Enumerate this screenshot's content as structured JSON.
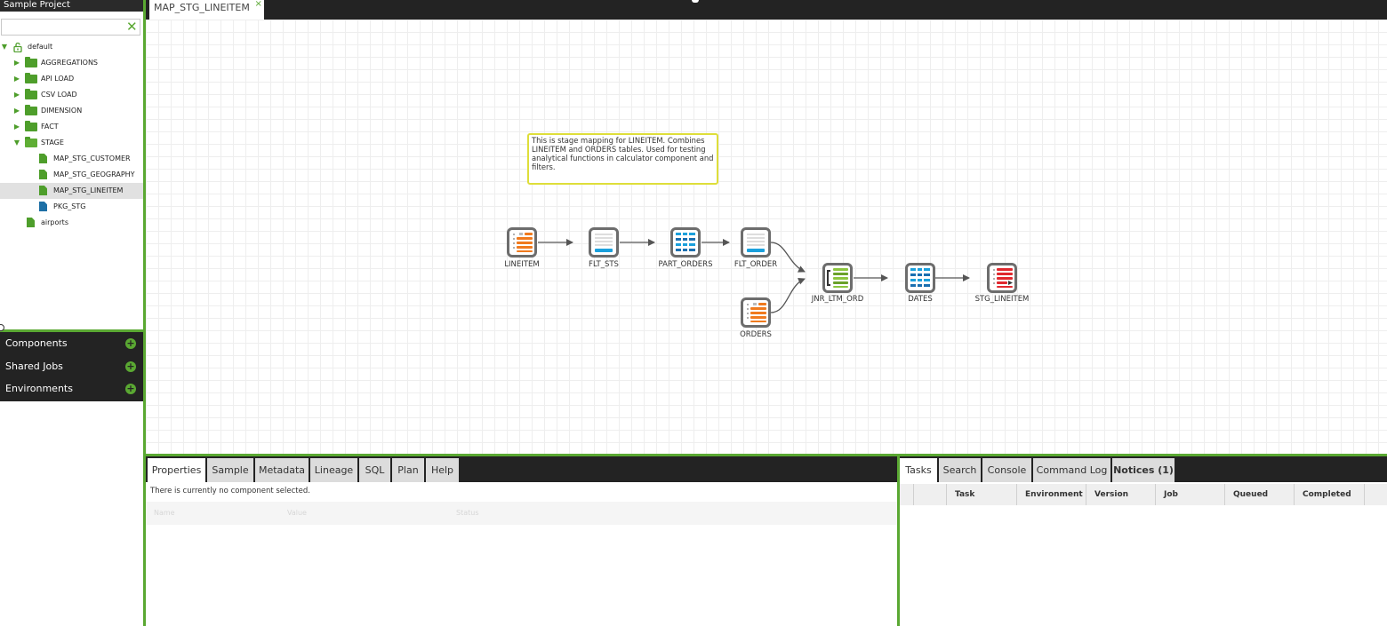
{
  "project": {
    "title": "Sample Project"
  },
  "search": {
    "value": "",
    "placeholder": ""
  },
  "tree": {
    "root": "default",
    "folders": [
      "AGGREGATIONS",
      "API LOAD",
      "CSV LOAD",
      "DIMENSION",
      "FACT"
    ],
    "stage": {
      "label": "STAGE",
      "children": [
        "MAP_STG_CUSTOMER",
        "MAP_STG_GEOGRAPHY",
        "MAP_STG_LINEITEM",
        "PKG_STG"
      ]
    },
    "airports": "airports"
  },
  "accordion": [
    "Components",
    "Shared Jobs",
    "Environments"
  ],
  "topbar": {
    "tab": "MAP_STG_LINEITEM",
    "close": "×"
  },
  "canvas": {
    "note": "This is stage mapping for LINEITEM. Combines LINEITEM and ORDERS tables. Used for testing analytical functions in calculator component and filters.",
    "nodes": {
      "lineitem": "LINEITEM",
      "flt_sts": "FLT_STS",
      "part_orders": "PART_ORDERS",
      "flt_order": "FLT_ORDER",
      "orders": "ORDERS",
      "jnr": "JNR_LTM_ORD",
      "dates": "DATES",
      "stg": "STG_LINEITEM"
    }
  },
  "props": {
    "tabs": [
      "Properties",
      "Sample",
      "Metadata",
      "Lineage",
      "SQL",
      "Plan",
      "Help"
    ],
    "message": "There is currently no component selected.",
    "columns": [
      "Name",
      "Value",
      "Status"
    ]
  },
  "tasks": {
    "tabs": [
      "Tasks",
      "Search",
      "Console",
      "Command Log",
      "Notices (1)"
    ],
    "columns": [
      "Task",
      "Environment",
      "Version",
      "Job",
      "Queued",
      "Completed"
    ]
  },
  "colors": {
    "accent": "#5aa832",
    "dark": "#232323",
    "source": "#f07a1e",
    "filter": "#1aa0dc",
    "join": "#8cc63f",
    "target": "#e0282e",
    "note_border": "#dede3a"
  }
}
